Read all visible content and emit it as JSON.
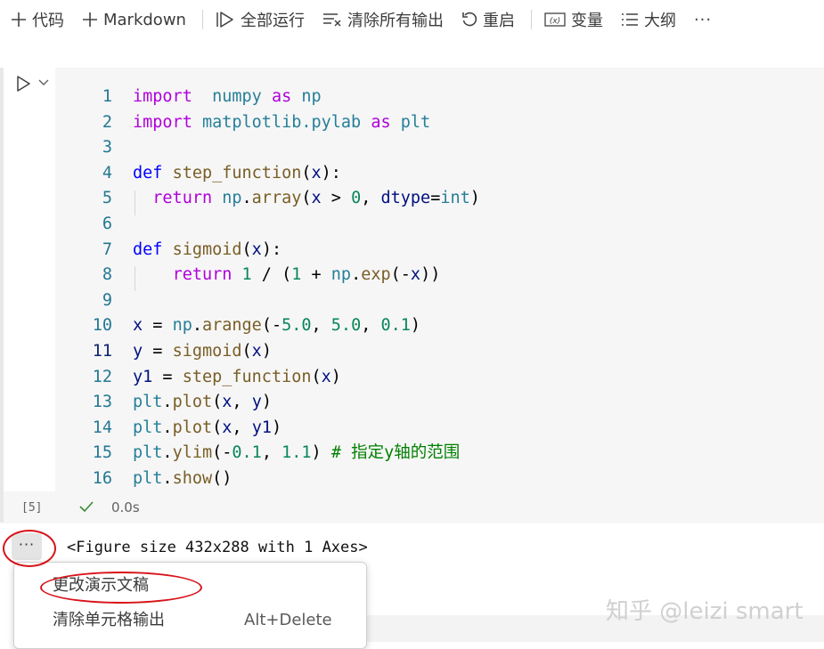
{
  "toolbar": {
    "add_code": "代码",
    "add_markdown": "Markdown",
    "run_all": "全部运行",
    "clear_outputs": "清除所有输出",
    "restart": "重启",
    "variables": "变量",
    "outline": "大纲",
    "more": "···"
  },
  "cell": {
    "lines": [
      {
        "n": "1",
        "tokens": [
          [
            "kw",
            "import"
          ],
          [
            "",
            "  "
          ],
          [
            "ty",
            "numpy"
          ],
          [
            "",
            " "
          ],
          [
            "kw",
            "as"
          ],
          [
            "",
            " "
          ],
          [
            "ty",
            "np"
          ]
        ]
      },
      {
        "n": "2",
        "tokens": [
          [
            "kw",
            "import"
          ],
          [
            "",
            " "
          ],
          [
            "ty",
            "matplotlib.pylab"
          ],
          [
            "",
            " "
          ],
          [
            "kw",
            "as"
          ],
          [
            "",
            " "
          ],
          [
            "ty",
            "plt"
          ]
        ]
      },
      {
        "n": "3",
        "tokens": []
      },
      {
        "n": "4",
        "tokens": [
          [
            "def",
            "def"
          ],
          [
            "",
            " "
          ],
          [
            "fn",
            "step_function"
          ],
          [
            "",
            "("
          ],
          [
            "var",
            "x"
          ],
          [
            "",
            "):"
          ]
        ]
      },
      {
        "n": "5",
        "tokens": [
          [
            "",
            "  "
          ],
          [
            "kw",
            "return"
          ],
          [
            "",
            " "
          ],
          [
            "ty",
            "np"
          ],
          [
            "",
            "."
          ],
          [
            "fn",
            "array"
          ],
          [
            "",
            "("
          ],
          [
            "var",
            "x"
          ],
          [
            "",
            " > "
          ],
          [
            "num",
            "0"
          ],
          [
            "",
            ", "
          ],
          [
            "var",
            "dtype"
          ],
          [
            "",
            "="
          ],
          [
            "ty",
            "int"
          ],
          [
            "",
            ")"
          ]
        ]
      },
      {
        "n": "6",
        "tokens": []
      },
      {
        "n": "7",
        "tokens": [
          [
            "def",
            "def"
          ],
          [
            "",
            " "
          ],
          [
            "fn",
            "sigmoid"
          ],
          [
            "",
            "("
          ],
          [
            "var",
            "x"
          ],
          [
            "",
            "):"
          ]
        ]
      },
      {
        "n": "8",
        "tokens": [
          [
            "",
            "    "
          ],
          [
            "kw",
            "return"
          ],
          [
            "",
            " "
          ],
          [
            "num",
            "1"
          ],
          [
            "",
            " / ("
          ],
          [
            "num",
            "1"
          ],
          [
            "",
            " + "
          ],
          [
            "ty",
            "np"
          ],
          [
            "",
            "."
          ],
          [
            "fn",
            "exp"
          ],
          [
            "",
            "(-"
          ],
          [
            "var",
            "x"
          ],
          [
            "",
            "))"
          ]
        ]
      },
      {
        "n": "9",
        "tokens": []
      },
      {
        "n": "10",
        "tokens": [
          [
            "var",
            "x"
          ],
          [
            "",
            " = "
          ],
          [
            "ty",
            "np"
          ],
          [
            "",
            "."
          ],
          [
            "fn",
            "arange"
          ],
          [
            "",
            "(-"
          ],
          [
            "num",
            "5.0"
          ],
          [
            "",
            ", "
          ],
          [
            "num",
            "5.0"
          ],
          [
            "",
            ", "
          ],
          [
            "num",
            "0.1"
          ],
          [
            "",
            ")"
          ]
        ]
      },
      {
        "n": "11",
        "active": true,
        "tokens": [
          [
            "var",
            "y"
          ],
          [
            "",
            " = "
          ],
          [
            "fn",
            "sigmoid"
          ],
          [
            "",
            "("
          ],
          [
            "var",
            "x"
          ],
          [
            "",
            ")"
          ]
        ]
      },
      {
        "n": "12",
        "tokens": [
          [
            "var",
            "y1"
          ],
          [
            "",
            " = "
          ],
          [
            "fn",
            "step_function"
          ],
          [
            "",
            "("
          ],
          [
            "var",
            "x"
          ],
          [
            "",
            ")"
          ]
        ]
      },
      {
        "n": "13",
        "tokens": [
          [
            "ty",
            "plt"
          ],
          [
            "",
            "."
          ],
          [
            "fn",
            "plot"
          ],
          [
            "",
            "("
          ],
          [
            "var",
            "x"
          ],
          [
            "",
            ", "
          ],
          [
            "var",
            "y"
          ],
          [
            "",
            ")"
          ]
        ]
      },
      {
        "n": "14",
        "tokens": [
          [
            "ty",
            "plt"
          ],
          [
            "",
            "."
          ],
          [
            "fn",
            "plot"
          ],
          [
            "",
            "("
          ],
          [
            "var",
            "x"
          ],
          [
            "",
            ", "
          ],
          [
            "var",
            "y1"
          ],
          [
            "",
            ")"
          ]
        ]
      },
      {
        "n": "15",
        "tokens": [
          [
            "ty",
            "plt"
          ],
          [
            "",
            "."
          ],
          [
            "fn",
            "ylim"
          ],
          [
            "",
            "(-"
          ],
          [
            "num",
            "0.1"
          ],
          [
            "",
            ", "
          ],
          [
            "num",
            "1.1"
          ],
          [
            "",
            ") "
          ],
          [
            "cm",
            "# 指定y轴的范围"
          ]
        ]
      },
      {
        "n": "16",
        "tokens": [
          [
            "ty",
            "plt"
          ],
          [
            "",
            "."
          ],
          [
            "fn",
            "show"
          ],
          [
            "",
            "()"
          ]
        ]
      }
    ],
    "exec_count": "[5]",
    "exec_time": "0.0s"
  },
  "output": {
    "more": "···",
    "text": "<Figure size 432x288 with 1 Axes>"
  },
  "context_menu": {
    "change_presentation": "更改演示文稿",
    "clear_cell_output": "清除单元格输出",
    "clear_cell_output_shortcut": "Alt+Delete"
  },
  "watermark": "知乎 @leizi smart",
  "colors": {
    "accent_blue": "#0000ff",
    "keyword_purple": "#af00db",
    "number_green": "#098658",
    "annotation_red": "#d7141a"
  }
}
